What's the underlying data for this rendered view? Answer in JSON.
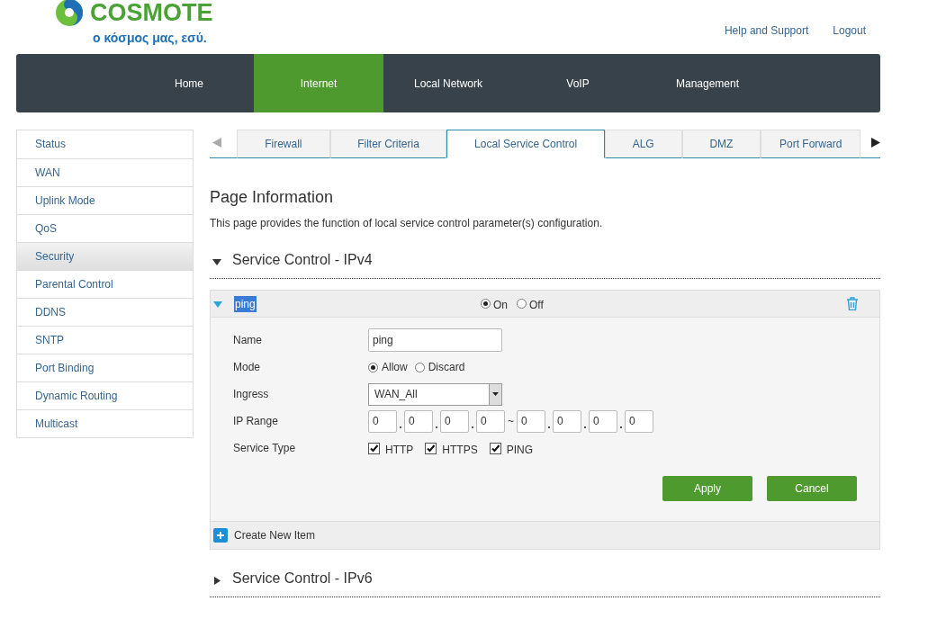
{
  "logo": {
    "name": "COSMOTE",
    "tagline": "ο κόσμος μας, εσύ."
  },
  "header_links": [
    "Help and Support",
    "Logout"
  ],
  "nav": [
    {
      "label": "Home",
      "selected": false
    },
    {
      "label": "Internet",
      "selected": true
    },
    {
      "label": "Local Network",
      "selected": false
    },
    {
      "label": "VoIP",
      "selected": false
    },
    {
      "label": "Management",
      "selected": false
    }
  ],
  "sidebar": {
    "items": [
      {
        "label": "Status",
        "selected": false
      },
      {
        "label": "WAN",
        "selected": false
      },
      {
        "label": "Uplink Mode",
        "selected": false
      },
      {
        "label": "QoS",
        "selected": false
      },
      {
        "label": "Security",
        "selected": true
      },
      {
        "label": "Parental Control",
        "selected": false
      },
      {
        "label": "DDNS",
        "selected": false
      },
      {
        "label": "SNTP",
        "selected": false
      },
      {
        "label": "Port Binding",
        "selected": false
      },
      {
        "label": "Dynamic Routing",
        "selected": false
      },
      {
        "label": "Multicast",
        "selected": false
      }
    ]
  },
  "tabs": [
    {
      "label": "Firewall",
      "selected": false
    },
    {
      "label": "Filter Criteria",
      "selected": false
    },
    {
      "label": "Local Service Control",
      "selected": true
    },
    {
      "label": "ALG",
      "selected": false
    },
    {
      "label": "DMZ",
      "selected": false
    },
    {
      "label": "Port Forward",
      "selected": false
    }
  ],
  "page": {
    "title": "Page Information",
    "description": "This page provides the function of local service control parameter(s) configuration."
  },
  "sections": [
    {
      "title": "Service Control - IPv4",
      "expanded": true,
      "items": [
        {
          "name": "ping",
          "expanded": true,
          "state_options": [
            {
              "label": "On",
              "selected": true
            },
            {
              "label": "Off",
              "selected": false
            }
          ],
          "form": {
            "name_label": "Name",
            "name_value": "ping",
            "mode_label": "Mode",
            "mode_options": [
              {
                "label": "Allow",
                "selected": true
              },
              {
                "label": "Discard",
                "selected": false
              }
            ],
            "ingress_label": "Ingress",
            "ingress_value": "WAN_All",
            "ip_label": "IP Range",
            "ip_start": [
              "0",
              "0",
              "0",
              "0"
            ],
            "ip_separator": "~",
            "ip_end": [
              "0",
              "0",
              "0",
              "0"
            ],
            "service_label": "Service Type",
            "services": [
              {
                "label": "HTTP",
                "checked": true
              },
              {
                "label": "HTTPS",
                "checked": true
              },
              {
                "label": "PING",
                "checked": true
              }
            ]
          },
          "buttons": [
            "Apply",
            "Cancel"
          ]
        }
      ],
      "create_label": "Create New Item"
    },
    {
      "title": "Service Control - IPv6",
      "expanded": false
    }
  ]
}
